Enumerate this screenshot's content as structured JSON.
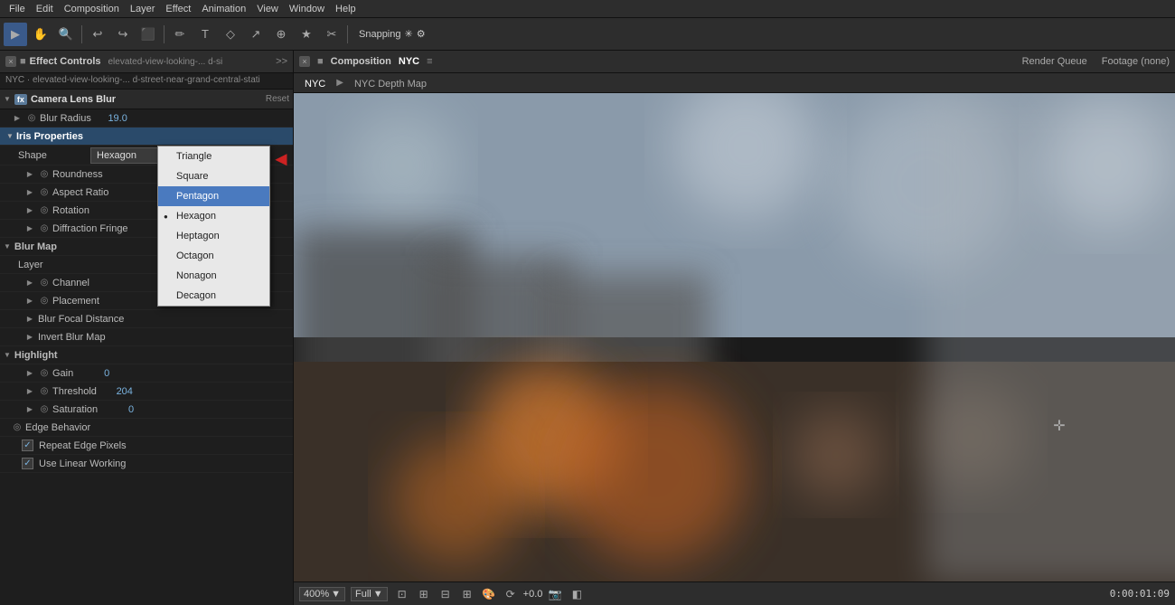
{
  "menubar": {
    "items": [
      "File",
      "Edit",
      "Composition",
      "Layer",
      "Effect",
      "Animation",
      "View",
      "Window",
      "Help"
    ]
  },
  "toolbar": {
    "snapping_label": "Snapping",
    "tools": [
      "▶",
      "✋",
      "🔍",
      "↩",
      "↺",
      "⬜",
      "✏",
      "T",
      "↗",
      "⊕",
      "★",
      "✂"
    ]
  },
  "left_panel": {
    "title": "Effect Controls",
    "file_name": "elevated-view-looking-... d-si",
    "source": "NYC · elevated-view-looking-... d-street-near-grand-central-stati",
    "effect_name": "Camera Lens Blur",
    "reset_label": "Reset",
    "blur_radius_label": "Blur Radius",
    "blur_radius_value": "19.0",
    "iris_properties_label": "Iris Properties",
    "shape_label": "Shape",
    "shape_value": "Hexagon",
    "roundness_label": "Roundness",
    "aspect_ratio_label": "Aspect Ratio",
    "rotation_label": "Rotation",
    "diffraction_fringe_label": "Diffraction Fringe",
    "blur_map_label": "Blur Map",
    "layer_label": "Layer",
    "channel_label": "Channel",
    "placement_label": "Placement",
    "blur_focal_distance_label": "Blur Focal Distance",
    "invert_blur_map_label": "Invert Blur Map",
    "highlight_label": "Highlight",
    "gain_label": "Gain",
    "gain_value": "0",
    "threshold_label": "Threshold",
    "threshold_value": "204",
    "saturation_label": "Saturation",
    "saturation_value": "0",
    "edge_behavior_label": "Edge Behavior",
    "repeat_edge_label": "Repeat Edge Pixels",
    "use_linear_label": "Use Linear Working",
    "dropdown_items": [
      {
        "label": "Triangle",
        "selected": false,
        "checked": false
      },
      {
        "label": "Square",
        "selected": false,
        "checked": false
      },
      {
        "label": "Pentagon",
        "selected": true,
        "checked": false
      },
      {
        "label": "Hexagon",
        "selected": false,
        "checked": true
      },
      {
        "label": "Heptagon",
        "selected": false,
        "checked": false
      },
      {
        "label": "Octagon",
        "selected": false,
        "checked": false
      },
      {
        "label": "Nonagon",
        "selected": false,
        "checked": false
      },
      {
        "label": "Decagon",
        "selected": false,
        "checked": false
      }
    ]
  },
  "right_panel": {
    "title": "Composition",
    "comp_name": "NYC",
    "tabs": [
      "NYC",
      "NYC Depth Map"
    ],
    "render_queue": "Render Queue",
    "footage": "Footage (none)"
  },
  "bottom_bar": {
    "zoom": "400%",
    "quality": "Full",
    "color_value": "+0.0",
    "timecode": "0:00:01:09"
  }
}
